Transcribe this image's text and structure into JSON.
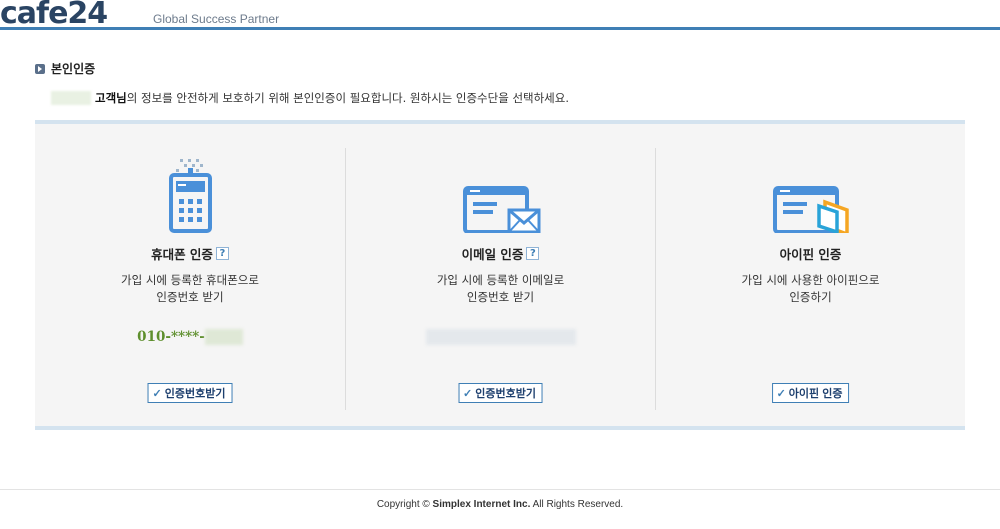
{
  "header": {
    "logo_text": "cafe24",
    "tagline": "Global Success Partner"
  },
  "section": {
    "title": "본인인증",
    "intro_bold": "고객님",
    "intro_rest": "의 정보를 안전하게 보호하기 위해 본인인증이 필요합니다. 원하시는 인증수단을 선택하세요."
  },
  "methods": [
    {
      "title": "휴대폰 인증",
      "help": "?",
      "desc_line1": "가입 시에 등록한 휴대폰으로",
      "desc_line2": "인증번호 받기",
      "value_prefix": "010-****-",
      "button_label": "인증번호받기"
    },
    {
      "title": "이메일 인증",
      "help": "?",
      "desc_line1": "가입 시에 등록한 이메일로",
      "desc_line2": "인증번호 받기",
      "button_label": "인증번호받기"
    },
    {
      "title": "아이핀 인증",
      "desc_line1": "가입 시에 사용한 아이핀으로",
      "desc_line2": "인증하기",
      "button_label": "아이핀 인증"
    }
  ],
  "footer": {
    "copyright_pre": "Copyright ",
    "copyright_symbol": "©",
    "company": "Simplex Internet Inc.",
    "rights": " All Rights Reserved."
  },
  "colors": {
    "accent": "#3f7fb5",
    "value_green": "#5e8f2d",
    "panel_bg": "#f5f5f5",
    "icon_blue": "#4a90d9",
    "icon_orange": "#f5a623"
  }
}
